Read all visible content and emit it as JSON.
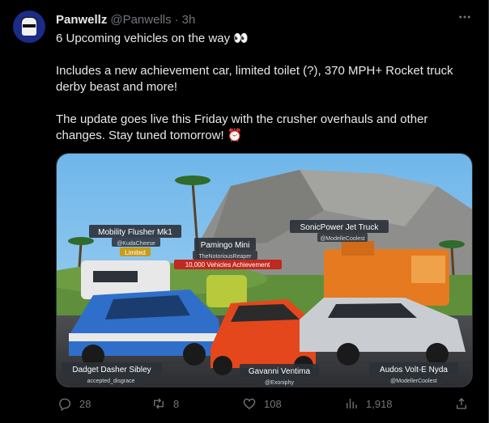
{
  "author": {
    "display_name": "Panwellz",
    "handle": "@Panwells",
    "separator": "·",
    "time_ago": "3h"
  },
  "post": {
    "line1": "6 Upcoming vehicles on the way 👀",
    "line2": "Includes a new achievement car, limited toilet (?), 370 MPH+ Rocket truck derby beast and more!",
    "line3": "The update goes live this Friday with the crusher overhauls and other changes. Stay tuned tomorrow! ⏰"
  },
  "media": {
    "vehicles": [
      {
        "name": "Mobility Flusher Mk1",
        "creator": "@KudaCheese",
        "tag": "Limited"
      },
      {
        "name": "Pamingo Mini",
        "creator": "TheNotoriousReaper",
        "tag": "10,000 Vehicles Achievement"
      },
      {
        "name": "SonicPower Jet Truck",
        "creator": "@ModelleCoolest"
      },
      {
        "name": "Dadget Dasher Sibley",
        "creator": "accepted_disgrace"
      },
      {
        "name": "Gavanni Ventima",
        "creator": "@Exoniphy"
      },
      {
        "name": "Audos Volt-E Nyda",
        "creator": "@ModellerCoolest"
      }
    ]
  },
  "actions": {
    "replies": "28",
    "reposts": "8",
    "likes": "108",
    "views": "1,918"
  },
  "icons": {
    "more": "more-horizontal-icon",
    "reply": "reply-icon",
    "repost": "repost-icon",
    "like": "heart-icon",
    "views": "views-chart-icon",
    "share": "share-icon"
  },
  "colors": {
    "background": "#000000",
    "text": "#e7e9ea",
    "muted": "#71767b",
    "achievement_badge": "#c0291f",
    "limited_badge": "#c79b1c"
  }
}
